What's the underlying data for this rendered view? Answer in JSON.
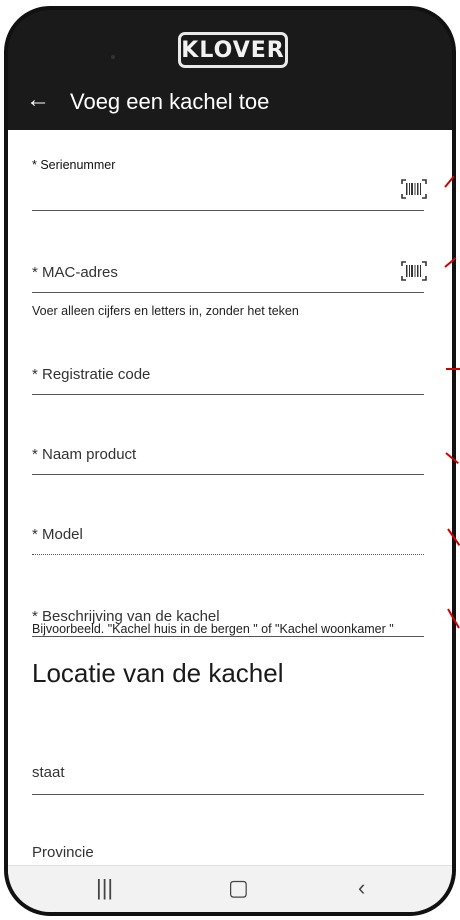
{
  "app": {
    "logo": "KLOVER",
    "title": "Voeg een kachel toe"
  },
  "form": {
    "serial_label": "* Serienummer",
    "mac_label": "* MAC-adres",
    "mac_hint": "Voer alleen cijfers en letters in, zonder het teken",
    "reg_label": "* Registratie code",
    "name_label": "* Naam product",
    "model_label": "* Model",
    "desc_label": "* Beschrijving van de kachel",
    "desc_hint": "Bijvoorbeeld. \"Kachel huis in de bergen \" of \"Kachel woonkamer \""
  },
  "location": {
    "heading": "Locatie van de kachel",
    "state_label": "staat",
    "province_label": "Provincie"
  },
  "icons": {
    "back": "arrow-left-icon",
    "scan": "barcode-scan-icon",
    "nav_recents": "recents-icon",
    "nav_home": "home-icon",
    "nav_back": "nav-back-icon"
  },
  "colors": {
    "topbar": "#1a1a1a",
    "annotation": "#d40000"
  }
}
